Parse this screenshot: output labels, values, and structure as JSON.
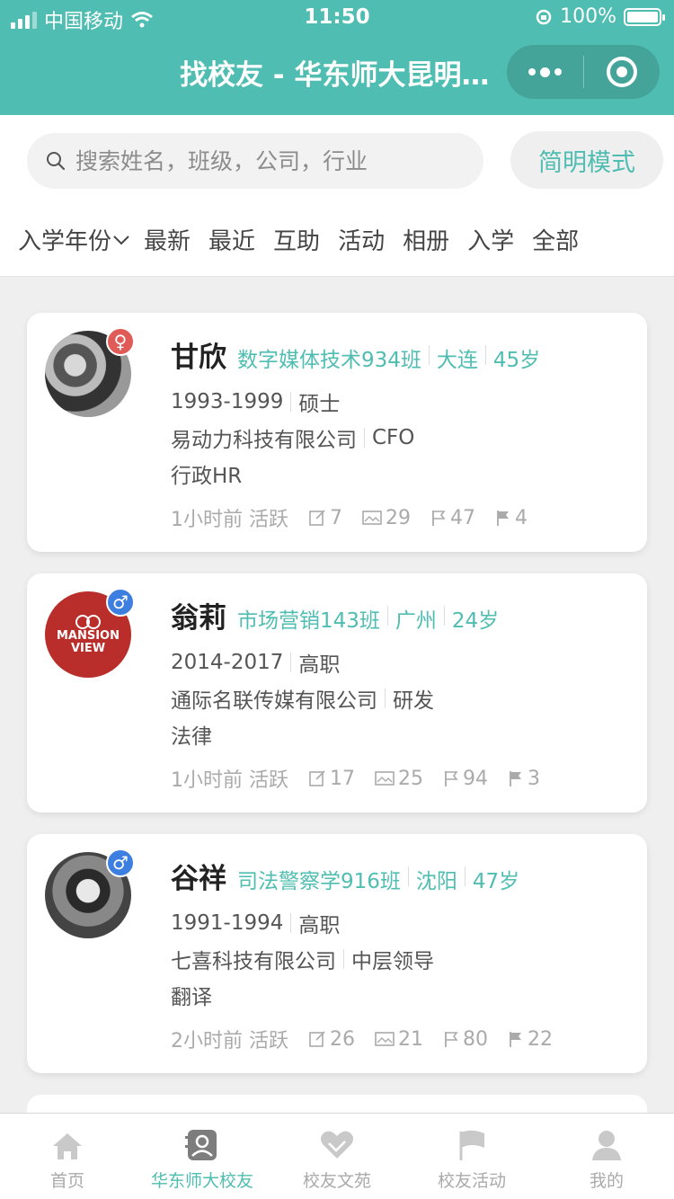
{
  "status": {
    "carrier": "中国移动",
    "time": "11:50",
    "battery": "100%"
  },
  "nav": {
    "title": "找校友 - 华东师大昆明校友会"
  },
  "search": {
    "placeholder": "搜索姓名，班级，公司，行业",
    "mode_button": "简明模式"
  },
  "filters": [
    "入学年份",
    "最新",
    "最近",
    "互助",
    "活动",
    "相册",
    "入学",
    "全部"
  ],
  "colors": {
    "accent": "#4fbdb1",
    "female": "#e05a57",
    "male": "#3d7fe0"
  },
  "cards": [
    {
      "name": "甘欣",
      "gender": "female",
      "gender_icon": "♀",
      "class": "数字媒体技术934班",
      "city": "大连",
      "age": "45岁",
      "years": "1993-1999",
      "degree": "硕士",
      "company": "易动力科技有限公司",
      "position": "CFO",
      "industry": "行政HR",
      "active": "1小时前 活跃",
      "posts": "7",
      "photos": "29",
      "replies": "47",
      "flags": "4"
    },
    {
      "name": "翁莉",
      "gender": "male",
      "gender_icon": "♂",
      "class": "市场营销143班",
      "city": "广州",
      "age": "24岁",
      "years": "2014-2017",
      "degree": "高职",
      "company": "通际名联传媒有限公司",
      "position": "研发",
      "industry": "法律",
      "active": "1小时前 活跃",
      "posts": "17",
      "photos": "25",
      "replies": "94",
      "flags": "3",
      "logo_text": [
        "MANSION",
        "VIEW"
      ]
    },
    {
      "name": "谷祥",
      "gender": "male",
      "gender_icon": "♂",
      "class": "司法警察学916班",
      "city": "沈阳",
      "age": "47岁",
      "years": "1991-1994",
      "degree": "高职",
      "company": "七喜科技有限公司",
      "position": "中层领导",
      "industry": "翻译",
      "active": "2小时前 活跃",
      "posts": "26",
      "photos": "21",
      "replies": "80",
      "flags": "22"
    }
  ],
  "tabs": [
    {
      "label": "首页",
      "icon": "home-icon"
    },
    {
      "label": "华东师大校友",
      "icon": "contacts-icon"
    },
    {
      "label": "校友文苑",
      "icon": "heart-hands-icon"
    },
    {
      "label": "校友活动",
      "icon": "flag-icon"
    },
    {
      "label": "我的",
      "icon": "user-icon"
    }
  ]
}
